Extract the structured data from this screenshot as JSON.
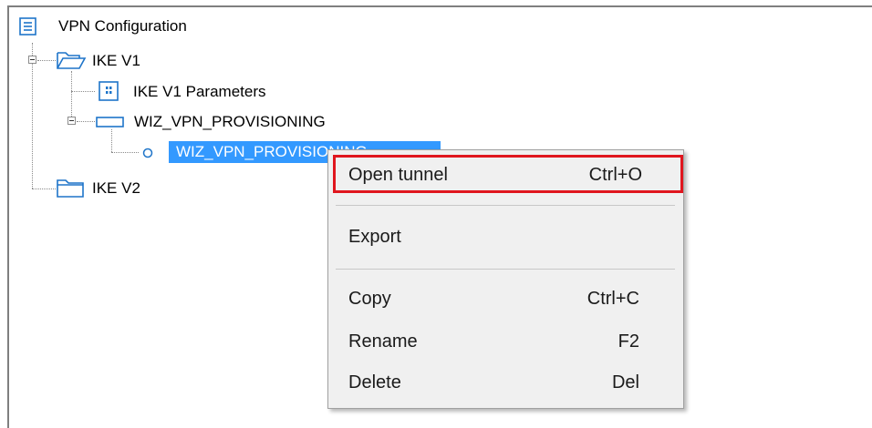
{
  "tree": {
    "root": {
      "label": "VPN Configuration",
      "icon": "list-document-icon"
    },
    "ike_v1": {
      "label": "IKE V1",
      "icon": "open-folder-icon",
      "expanded": true
    },
    "ike_v1_parameters": {
      "label": "IKE V1 Parameters",
      "icon": "parameters-icon"
    },
    "gateway": {
      "label": "WIZ_VPN_PROVISIONING",
      "icon": "gateway-icon",
      "expanded": true
    },
    "tunnel": {
      "label": "WIZ_VPN_PROVISIONING",
      "icon": "tunnel-circle-icon",
      "selected": true
    },
    "ike_v2": {
      "label": "IKE V2",
      "icon": "folder-icon"
    }
  },
  "context_menu": {
    "items": [
      {
        "label": "Open tunnel",
        "shortcut": "Ctrl+O",
        "highlighted": true
      },
      {
        "label": "Export",
        "shortcut": ""
      },
      {
        "label": "Copy",
        "shortcut": "Ctrl+C"
      },
      {
        "label": "Rename",
        "shortcut": "F2"
      },
      {
        "label": "Delete",
        "shortcut": "Del"
      }
    ]
  },
  "colors": {
    "selection": "#3399ff",
    "highlight_border": "#e0161e",
    "icon_blue": "#1e74c9",
    "menu_background": "#f0f0f0"
  }
}
